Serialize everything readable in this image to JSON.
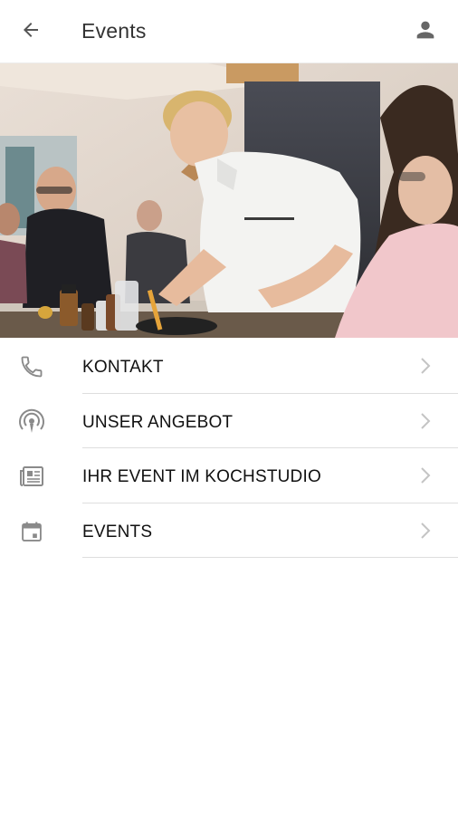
{
  "header": {
    "title": "Events",
    "back_icon": "arrow-back-icon",
    "account_icon": "account-icon"
  },
  "hero": {
    "image": "chef cooking at event in kitchen studio"
  },
  "menu": {
    "items": [
      {
        "label": "KONTAKT",
        "icon": "phone-icon"
      },
      {
        "label": "UNSER ANGEBOT",
        "icon": "podcast-icon"
      },
      {
        "label": "IHR EVENT IM KOCHSTUDIO",
        "icon": "newspaper-icon"
      },
      {
        "label": "EVENTS",
        "icon": "calendar-icon"
      }
    ]
  },
  "colors": {
    "icon_gray": "#8a8a8a",
    "chevron_gray": "#c4c4c4",
    "divider": "#dedede"
  }
}
